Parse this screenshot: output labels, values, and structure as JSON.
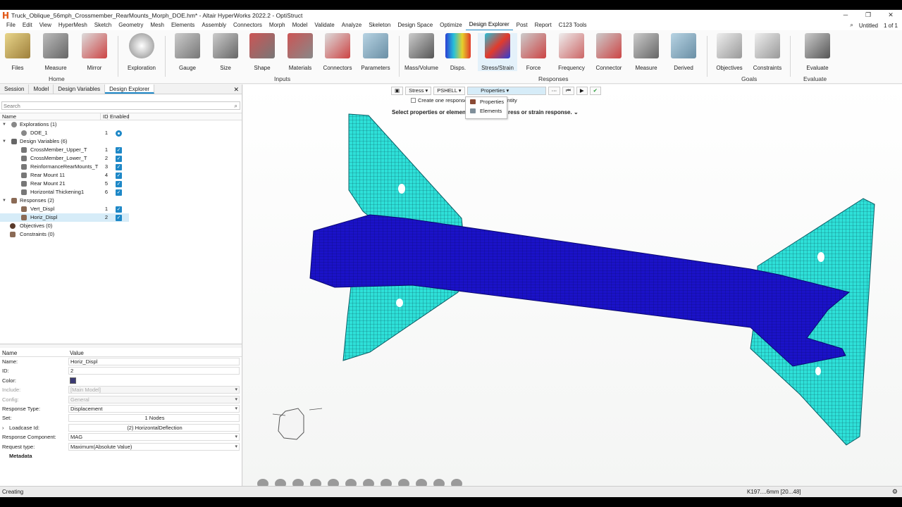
{
  "window": {
    "title": "Truck_Oblique_56mph_Crossmember_RearMounts_Morph_DOE.hm* - Altair HyperWorks 2022.2 - OptiStruct"
  },
  "menu": {
    "items": [
      "File",
      "Edit",
      "View",
      "HyperMesh",
      "Sketch",
      "Geometry",
      "Mesh",
      "Elements",
      "Assembly",
      "Connectors",
      "Morph",
      "Model",
      "Validate",
      "Analyze",
      "Skeleton",
      "Design Space",
      "Optimize",
      "Design Explorer",
      "Post",
      "Report",
      "C123 Tools"
    ],
    "active": "Design Explorer",
    "session_name": "Untitled",
    "page": "1 of 1"
  },
  "ribbon": {
    "tools": [
      {
        "label": "Files"
      },
      {
        "label": "Measure"
      },
      {
        "label": "Mirror"
      },
      {
        "label": "Exploration"
      },
      {
        "label": "Gauge"
      },
      {
        "label": "Size"
      },
      {
        "label": "Shape"
      },
      {
        "label": "Materials"
      },
      {
        "label": "Connectors"
      },
      {
        "label": "Parameters"
      },
      {
        "label": "Mass/Volume"
      },
      {
        "label": "Disps."
      },
      {
        "label": "Stress/Strain"
      },
      {
        "label": "Force"
      },
      {
        "label": "Frequency"
      },
      {
        "label": "Connector"
      },
      {
        "label": "Measure"
      },
      {
        "label": "Derived"
      },
      {
        "label": "Objectives"
      },
      {
        "label": "Constraints"
      },
      {
        "label": "Evaluate"
      }
    ],
    "groups": {
      "home": "Home",
      "inputs": "Inputs",
      "responses": "Responses",
      "goals": "Goals",
      "evaluate": "Evaluate"
    }
  },
  "panel": {
    "tabs": [
      "Session",
      "Model",
      "Design Variables",
      "Design Explorer"
    ],
    "active_tab": "Design Explorer",
    "search_placeholder": "Search",
    "columns": {
      "name": "Name",
      "id": "ID",
      "enabled": "Enabled"
    },
    "tree": {
      "explorations": "Explorations (1)",
      "doe": {
        "name": "DOE_1",
        "id": "1"
      },
      "design_variables": "Design Variables (6)",
      "dvs": [
        {
          "name": "CrossMember_Upper_T",
          "id": "1"
        },
        {
          "name": "CrossMember_Lower_T",
          "id": "2"
        },
        {
          "name": "ReinformanceRearMounts_T",
          "id": "3"
        },
        {
          "name": "Rear Mount 11",
          "id": "4"
        },
        {
          "name": "Rear Mount 21",
          "id": "5"
        },
        {
          "name": "Horizontal Thickening1",
          "id": "6"
        }
      ],
      "responses": "Responses (2)",
      "resps": [
        {
          "name": "Vert_Displ",
          "id": "1"
        },
        {
          "name": "Horiz_Displ",
          "id": "2"
        }
      ],
      "objectives": "Objectives (0)",
      "constraints": "Constraints (0)"
    }
  },
  "properties": {
    "head": {
      "name": "Name",
      "value": "Value"
    },
    "rows": {
      "name": {
        "k": "Name:",
        "v": "Horiz_Displ"
      },
      "id": {
        "k": "ID:",
        "v": "2"
      },
      "color": {
        "k": "Color:",
        "v": "#3b3a73"
      },
      "include": {
        "k": "Include:",
        "v": "[Main Model]"
      },
      "config": {
        "k": "Config:",
        "v": "General"
      },
      "response_type": {
        "k": "Response Type:",
        "v": "Displacement"
      },
      "set": {
        "k": "Set:",
        "v": "1 Nodes"
      },
      "loadcase": {
        "k": "Loadcase Id:",
        "v": "(2) HorizontalDeflection"
      },
      "component": {
        "k": "Response Component:",
        "v": "MAG"
      },
      "request_type": {
        "k": "Request type:",
        "v": "Maximum(Absolute Value)"
      },
      "metadata": {
        "k": "Metadata"
      }
    }
  },
  "context": {
    "type": "Stress",
    "card": "PSHELL",
    "entity": "Properties",
    "create_one": "Create one response",
    "entity_suffix": "ntity",
    "message": "Select properties or elemen",
    "message2": "ress or strain response.",
    "menu": [
      "Properties",
      "Elements"
    ]
  },
  "statusbar": {
    "left": "Creating",
    "right": "K197....6mm [20...48]"
  }
}
